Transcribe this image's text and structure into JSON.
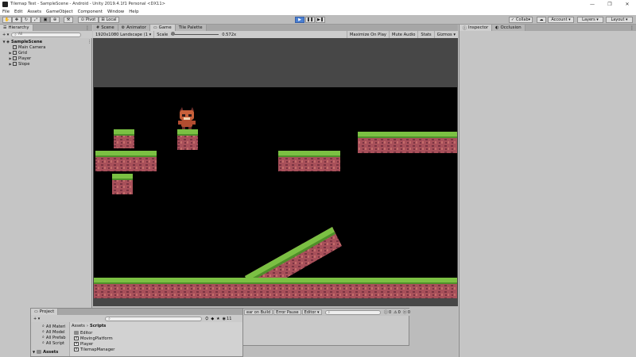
{
  "window": {
    "title": "Tilemap Test - SampleScene - Android - Unity 2019.4.1f1 Personal <DX11>",
    "controls": [
      "—",
      "❐",
      "✕"
    ]
  },
  "menu": [
    "File",
    "Edit",
    "Assets",
    "GameObject",
    "Component",
    "Window",
    "Help"
  ],
  "toolbar": {
    "pivot": "Pivot",
    "local": "Local",
    "collab": "Collab",
    "account": "Account",
    "layers": "Layers",
    "layout": "Layout"
  },
  "hierarchy": {
    "tab": "Hierarchy",
    "search_placeholder": "All",
    "create": "+ ▾",
    "scene": "SampleScene",
    "items": [
      "Main Camera",
      "Grid",
      "Player",
      "Slope"
    ]
  },
  "center_tabs": [
    "Scene",
    "Animator",
    "Game",
    "Tile Palette"
  ],
  "game": {
    "resolution": "1920x1080 Landscape (1 ▾",
    "scale_label": "Scale",
    "scale_value": "0.572x",
    "options": [
      "Maximize On Play",
      "Mute Audio",
      "Stats",
      "Gizmos ▾"
    ]
  },
  "inspector": {
    "tabs": [
      "Inspector",
      "Occlusion"
    ]
  },
  "project": {
    "tab": "Project",
    "favorites": [
      "All Materi",
      "All Model",
      "All Prefab",
      "All Script"
    ],
    "assets_root": "Assets",
    "breadcrumb": [
      "Assets",
      "Scripts"
    ],
    "files": [
      {
        "name": "Editor",
        "type": "folder"
      },
      {
        "name": "MovingPlatform",
        "type": "script"
      },
      {
        "name": "Player",
        "type": "script"
      },
      {
        "name": "TilemapManager",
        "type": "script"
      }
    ],
    "count": "11"
  },
  "console": {
    "buttons": [
      "ear on Build",
      "Error Pause",
      "Editor ▾"
    ],
    "counts": [
      "0",
      "0",
      "0"
    ]
  },
  "colors": {
    "grass": "#7bc043",
    "grass_dark": "#4f8f2a",
    "dirt": "#a8505a",
    "dirt_dark": "#7a3442",
    "accent_play": "#4a7fd1"
  }
}
